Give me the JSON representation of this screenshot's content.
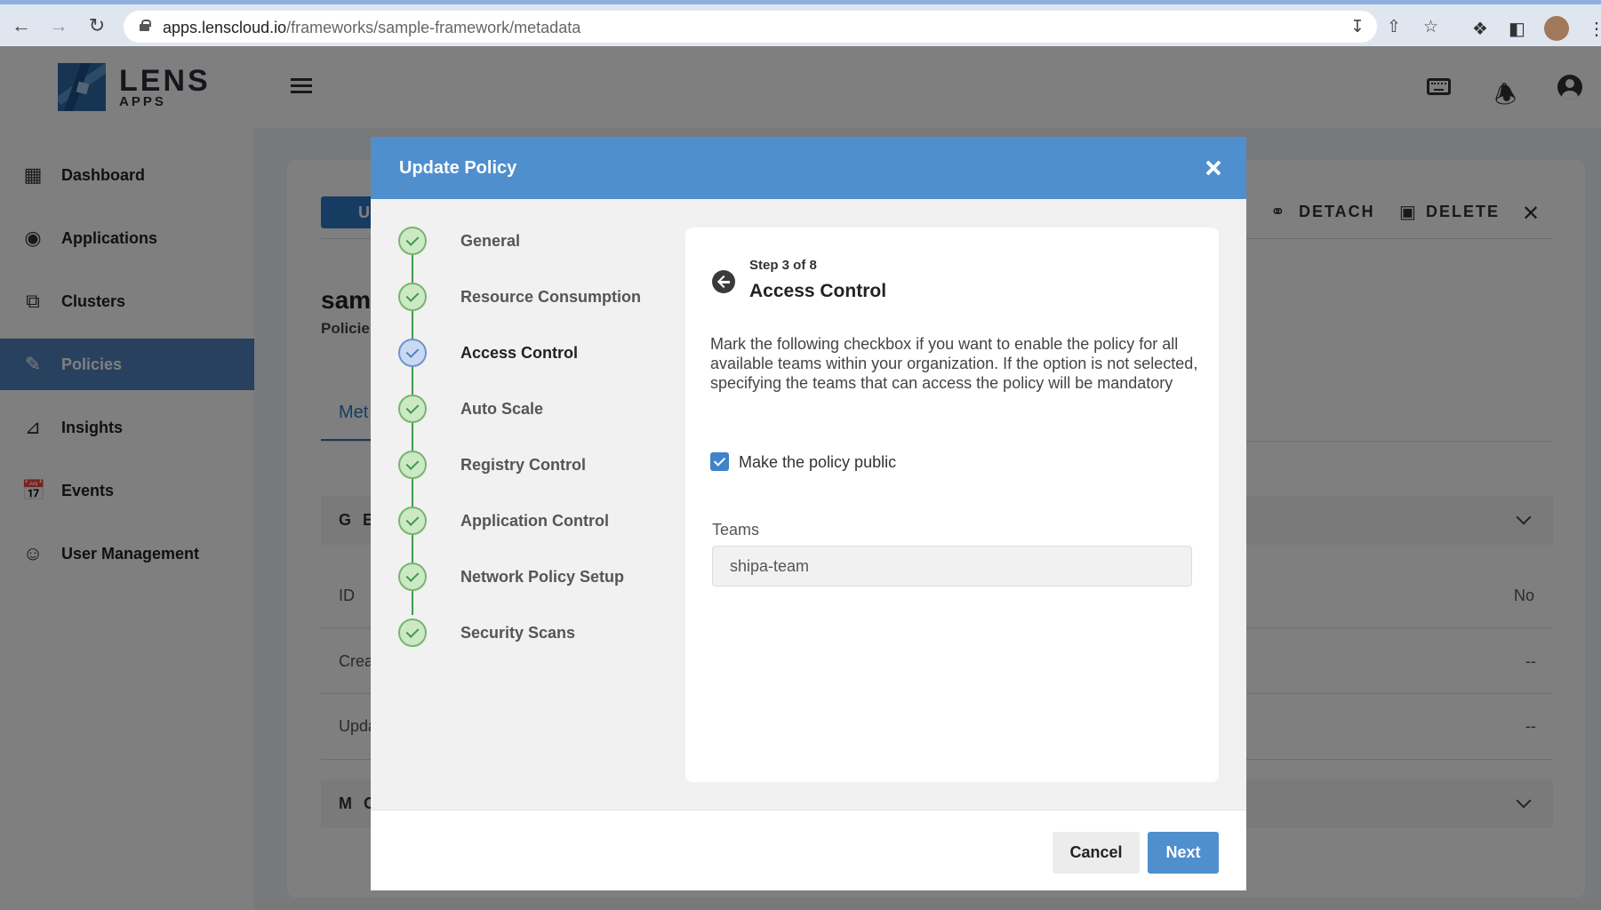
{
  "browser": {
    "url_host": "apps.lenscloud.io",
    "url_path": "/frameworks/sample-framework/metadata"
  },
  "header": {
    "logo_text": "LENS",
    "logo_sub": "APPS"
  },
  "sidebar": {
    "items": [
      {
        "label": "Dashboard",
        "icon": "dashboard-icon"
      },
      {
        "label": "Applications",
        "icon": "applications-icon"
      },
      {
        "label": "Clusters",
        "icon": "clusters-icon"
      },
      {
        "label": "Policies",
        "icon": "policies-icon",
        "active": true
      },
      {
        "label": "Insights",
        "icon": "insights-icon"
      },
      {
        "label": "Events",
        "icon": "events-icon"
      },
      {
        "label": "User Management",
        "icon": "users-icon"
      }
    ]
  },
  "background": {
    "title": "sam",
    "subtitle": "Policie",
    "tab": "Met",
    "section_general": "G E",
    "section_more": "M O",
    "rows": [
      {
        "label": "ID",
        "value": "No"
      },
      {
        "label": "Crea",
        "value": "--"
      },
      {
        "label": "Upda",
        "value": "--"
      }
    ],
    "update_label": "U",
    "detach_label": "DETACH",
    "delete_label": "DELETE"
  },
  "modal": {
    "title": "Update Policy",
    "steps": [
      {
        "label": "General",
        "status": "done"
      },
      {
        "label": "Resource Consumption",
        "status": "done"
      },
      {
        "label": "Access Control",
        "status": "current"
      },
      {
        "label": "Auto Scale",
        "status": "done"
      },
      {
        "label": "Registry Control",
        "status": "done"
      },
      {
        "label": "Application Control",
        "status": "done"
      },
      {
        "label": "Network Policy Setup",
        "status": "done"
      },
      {
        "label": "Security Scans",
        "status": "done"
      }
    ],
    "panel": {
      "step_counter": "Step 3 of 8",
      "title": "Access Control",
      "description": "Mark the following checkbox if you want to enable the policy for all available teams within your organization. If the option is not selected, specifying the teams that can access the policy will be mandatory",
      "checkbox_label": "Make the policy public",
      "checkbox_checked": true,
      "teams_label": "Teams",
      "teams_value": "shipa-team"
    },
    "footer": {
      "cancel_label": "Cancel",
      "next_label": "Next"
    }
  },
  "colors": {
    "accent": "#4f8fce",
    "sidebar_active": "#4f82bd",
    "step_done": "#3d9b4c"
  }
}
